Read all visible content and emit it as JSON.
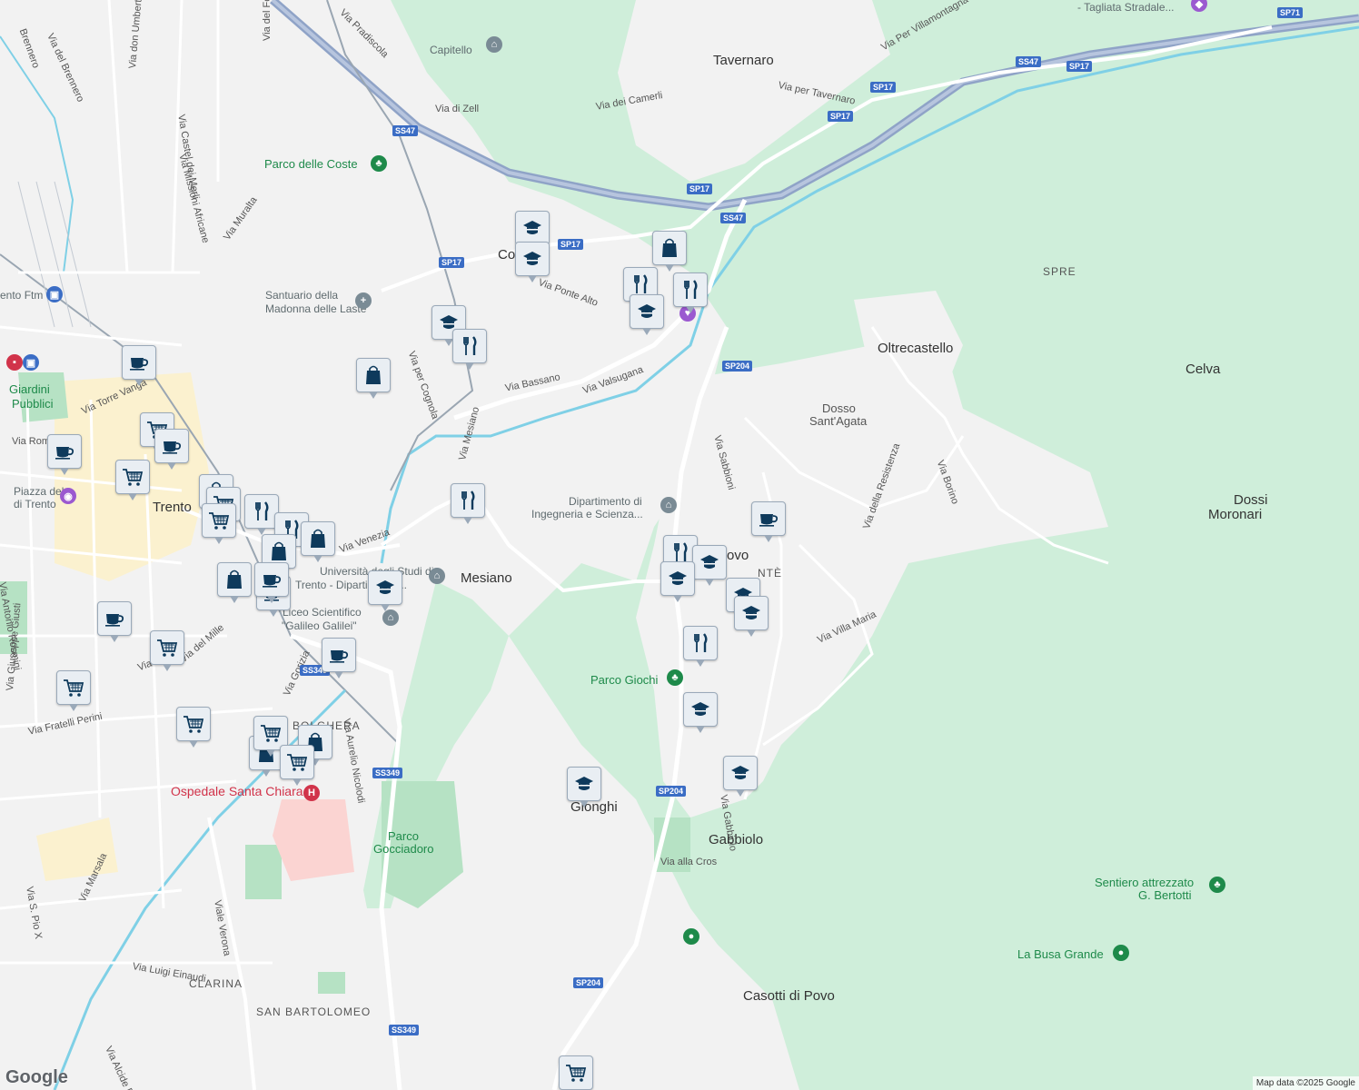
{
  "map": {
    "attribution": "Map data ©2025 Google",
    "logo": "Google",
    "colors": {
      "land": "#f2f2f2",
      "forest": "#cfeeda",
      "park": "#b6e2c4",
      "highway": "#8fa3c7",
      "river": "#7fd0e6",
      "rail": "#9aa6b2",
      "marker": "#0e3a5c"
    }
  },
  "places": [
    {
      "id": "trento",
      "text": "Trento",
      "cls": "place"
    },
    {
      "id": "tavernaro",
      "text": "Tavernaro",
      "cls": "place"
    },
    {
      "id": "oltrecastello",
      "text": "Oltrecastello",
      "cls": "place"
    },
    {
      "id": "celva",
      "text": "Celva",
      "cls": "place"
    },
    {
      "id": "spre",
      "text": "SPRE",
      "cls": "district"
    },
    {
      "id": "dossi",
      "text": "Dossi",
      "cls": "place"
    },
    {
      "id": "moronari",
      "text": "Moronari",
      "cls": "place"
    },
    {
      "id": "mesiano",
      "text": "Mesiano",
      "cls": "place"
    },
    {
      "id": "gabbiolo",
      "text": "Gabbiolo",
      "cls": "place"
    },
    {
      "id": "gionghi",
      "text": "Gionghi",
      "cls": "place"
    },
    {
      "id": "casotti",
      "text": "Casotti di Povo",
      "cls": "place"
    },
    {
      "id": "povo",
      "text": "ovo",
      "cls": "place"
    },
    {
      "id": "ponte",
      "text": "NTÈ",
      "cls": "district"
    },
    {
      "id": "cognola",
      "text": "Co",
      "cls": "place"
    },
    {
      "id": "bolghera",
      "text": "BOLGHERA",
      "cls": "district"
    },
    {
      "id": "clarina",
      "text": "CLARINA",
      "cls": "district"
    },
    {
      "id": "sanbartolomeo",
      "text": "SAN BARTOLOMEO",
      "cls": "district"
    },
    {
      "id": "dosso1",
      "text": "Dosso",
      "cls": "small-place"
    },
    {
      "id": "dosso2",
      "text": "Sant'Agata",
      "cls": "small-place"
    }
  ],
  "pois": [
    {
      "id": "capitello",
      "text": "Capitello",
      "cls": "poi"
    },
    {
      "id": "coste",
      "text": "Parco delle Coste",
      "cls": "park"
    },
    {
      "id": "santuario1",
      "text": "Santuario della",
      "cls": "poi"
    },
    {
      "id": "santuario2",
      "text": "Madonna delle Laste",
      "cls": "poi"
    },
    {
      "id": "dip1",
      "text": "Dipartimento di",
      "cls": "poi"
    },
    {
      "id": "dip2",
      "text": "Ingegneria e Scienza...",
      "cls": "poi"
    },
    {
      "id": "uni1",
      "text": "Università degli Studi di",
      "cls": "poi"
    },
    {
      "id": "uni2",
      "text": "Trento - Dipartimento...",
      "cls": "poi"
    },
    {
      "id": "liceo1",
      "text": "Liceo Scientifico",
      "cls": "poi"
    },
    {
      "id": "liceo2",
      "text": "\"Galileo Galilei\"",
      "cls": "poi"
    },
    {
      "id": "parcogiochi",
      "text": "Parco Giochi",
      "cls": "park"
    },
    {
      "id": "gocciadoro1",
      "text": "Parco",
      "cls": "park"
    },
    {
      "id": "gocciadoro2",
      "text": "Gocciadoro",
      "cls": "park"
    },
    {
      "id": "hospital",
      "text": "Ospedale Santa Chiara",
      "cls": "hosp"
    },
    {
      "id": "sentiero1",
      "text": "Sentiero attrezzato",
      "cls": "park"
    },
    {
      "id": "sentiero2",
      "text": "G. Bertotti",
      "cls": "park"
    },
    {
      "id": "busa",
      "text": "La Busa Grande",
      "cls": "park"
    },
    {
      "id": "giardini1",
      "text": "Giardini",
      "cls": "park"
    },
    {
      "id": "giardini2",
      "text": "Pubblici",
      "cls": "park"
    },
    {
      "id": "piazza1",
      "text": "Piazza del",
      "cls": "poi"
    },
    {
      "id": "piazza2",
      "text": "di Trento",
      "cls": "poi"
    },
    {
      "id": "tagliata",
      "text": "- Tagliata Stradale...",
      "cls": "poi"
    },
    {
      "id": "ftm",
      "text": "ento Ftm",
      "cls": "poi"
    }
  ],
  "streets": [
    {
      "id": "s1",
      "text": "Via Pradiscola"
    },
    {
      "id": "s2",
      "text": "Via di Zell"
    },
    {
      "id": "s3",
      "text": "Via dei Camerli"
    },
    {
      "id": "s4",
      "text": "Via per Tavernaro"
    },
    {
      "id": "s5",
      "text": "Via Per Villamontagna"
    },
    {
      "id": "s6",
      "text": "Via Ponte Alto"
    },
    {
      "id": "s7",
      "text": "Via Bassano"
    },
    {
      "id": "s8",
      "text": "Via Valsugana"
    },
    {
      "id": "s9",
      "text": "Via per Cognola"
    },
    {
      "id": "s10",
      "text": "Via Mesiano"
    },
    {
      "id": "s11",
      "text": "Via Sabbioni"
    },
    {
      "id": "s12",
      "text": "Via della Resistenza"
    },
    {
      "id": "s13",
      "text": "Via Borino"
    },
    {
      "id": "s14",
      "text": "Via Villa Maria"
    },
    {
      "id": "s15",
      "text": "Via alla Cros"
    },
    {
      "id": "s16",
      "text": "Via Gabbiolo"
    },
    {
      "id": "s17",
      "text": "Via Venezia"
    },
    {
      "id": "s18",
      "text": "Via Gorizia"
    },
    {
      "id": "s19",
      "text": "Via Aurelio Nicolodi"
    },
    {
      "id": "s20",
      "text": "Via del Mille"
    },
    {
      "id": "s21",
      "text": "Via Fratelli Perini"
    },
    {
      "id": "s22",
      "text": "Via Giuseppe Giusti"
    },
    {
      "id": "s23",
      "text": "Via Antonio Rosmini"
    },
    {
      "id": "s24",
      "text": "Via S. Pio X"
    },
    {
      "id": "s25",
      "text": "Via Marsala"
    },
    {
      "id": "s26",
      "text": "Viale Verona"
    },
    {
      "id": "s27",
      "text": "Via Luigi Einaudi"
    },
    {
      "id": "s28",
      "text": "Via Alcide Degasperi"
    },
    {
      "id": "s29",
      "text": "Via del Brennero"
    },
    {
      "id": "s30",
      "text": "Brennero"
    },
    {
      "id": "s31",
      "text": "Via don Umberto Pessina"
    },
    {
      "id": "s32",
      "text": "Via Castel dei Merli"
    },
    {
      "id": "s33",
      "text": "Via Missioni Africane"
    },
    {
      "id": "s34",
      "text": "Via del Forte"
    },
    {
      "id": "s35",
      "text": "Via Muralta"
    },
    {
      "id": "s36",
      "text": "Via Torre Vanga"
    },
    {
      "id": "s37",
      "text": "Via Roma"
    },
    {
      "id": "s38",
      "text": "Via Fratelli"
    }
  ],
  "shields": [
    {
      "id": "r1",
      "text": "SS47"
    },
    {
      "id": "r2",
      "text": "SS47"
    },
    {
      "id": "r3",
      "text": "SS47"
    },
    {
      "id": "r4",
      "text": "SP17"
    },
    {
      "id": "r5",
      "text": "SP17"
    },
    {
      "id": "r6",
      "text": "SP17"
    },
    {
      "id": "r7",
      "text": "SP17"
    },
    {
      "id": "r8",
      "text": "SP17"
    },
    {
      "id": "r9",
      "text": "SP17"
    },
    {
      "id": "r10",
      "text": "SP71"
    },
    {
      "id": "r11",
      "text": "SP204"
    },
    {
      "id": "r12",
      "text": "SP204"
    },
    {
      "id": "r13",
      "text": "SP204"
    },
    {
      "id": "r14",
      "text": "SS349"
    },
    {
      "id": "r15",
      "text": "SS349"
    },
    {
      "id": "r16",
      "text": "SS349"
    }
  ],
  "markers": [
    {
      "type": "school"
    },
    {
      "type": "school"
    },
    {
      "type": "shop"
    },
    {
      "type": "restaurant"
    },
    {
      "type": "restaurant"
    },
    {
      "type": "school"
    },
    {
      "type": "school"
    },
    {
      "type": "restaurant"
    },
    {
      "type": "shop"
    },
    {
      "type": "cafe"
    },
    {
      "type": "grocery"
    },
    {
      "type": "cafe"
    },
    {
      "type": "cafe"
    },
    {
      "type": "grocery"
    },
    {
      "type": "shop"
    },
    {
      "type": "grocery"
    },
    {
      "type": "grocery"
    },
    {
      "type": "restaurant"
    },
    {
      "type": "restaurant"
    },
    {
      "type": "shop"
    },
    {
      "type": "shop"
    },
    {
      "type": "shop"
    },
    {
      "type": "cafe"
    },
    {
      "type": "cafe"
    },
    {
      "type": "school"
    },
    {
      "type": "cafe"
    },
    {
      "type": "grocery"
    },
    {
      "type": "cafe"
    },
    {
      "type": "grocery"
    },
    {
      "type": "grocery"
    },
    {
      "type": "shop"
    },
    {
      "type": "shop"
    },
    {
      "type": "grocery"
    },
    {
      "type": "grocery"
    },
    {
      "type": "restaurant"
    },
    {
      "type": "cafe"
    },
    {
      "type": "restaurant"
    },
    {
      "type": "school"
    },
    {
      "type": "school"
    },
    {
      "type": "school"
    },
    {
      "type": "school"
    },
    {
      "type": "restaurant"
    },
    {
      "type": "school"
    },
    {
      "type": "school"
    },
    {
      "type": "school"
    },
    {
      "type": "grocery"
    }
  ]
}
